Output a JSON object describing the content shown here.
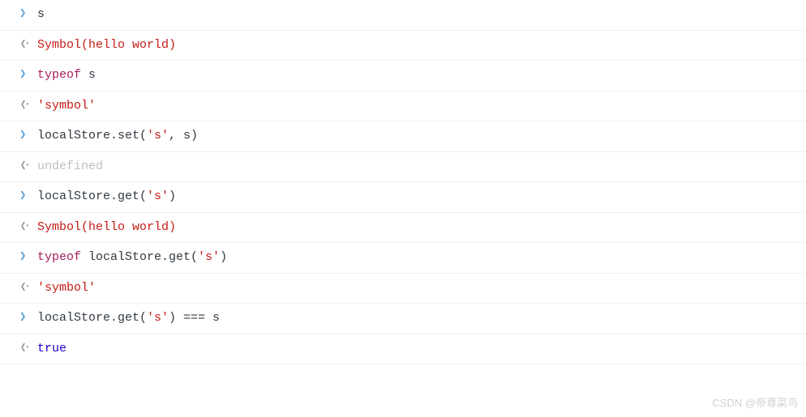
{
  "entries": [
    {
      "kind": "input",
      "tokens": [
        {
          "cls": "ident",
          "t": "s"
        }
      ]
    },
    {
      "kind": "output",
      "tokens": [
        {
          "cls": "sym",
          "t": "Symbol(hello world)"
        }
      ]
    },
    {
      "kind": "input",
      "tokens": [
        {
          "cls": "kw",
          "t": "typeof"
        },
        {
          "cls": "ident",
          "t": " s"
        }
      ]
    },
    {
      "kind": "output",
      "tokens": [
        {
          "cls": "str",
          "t": "'symbol'"
        }
      ]
    },
    {
      "kind": "input",
      "tokens": [
        {
          "cls": "ident",
          "t": "localStore.set("
        },
        {
          "cls": "str",
          "t": "'s'"
        },
        {
          "cls": "ident",
          "t": ", s)"
        }
      ]
    },
    {
      "kind": "output",
      "tokens": [
        {
          "cls": "undef",
          "t": "undefined"
        }
      ]
    },
    {
      "kind": "input",
      "tokens": [
        {
          "cls": "ident",
          "t": "localStore.get("
        },
        {
          "cls": "str",
          "t": "'s'"
        },
        {
          "cls": "ident",
          "t": ")"
        }
      ]
    },
    {
      "kind": "output",
      "tokens": [
        {
          "cls": "sym",
          "t": "Symbol(hello world)"
        }
      ]
    },
    {
      "kind": "input",
      "tokens": [
        {
          "cls": "kw",
          "t": "typeof"
        },
        {
          "cls": "ident",
          "t": " localStore.get("
        },
        {
          "cls": "str",
          "t": "'s'"
        },
        {
          "cls": "ident",
          "t": ")"
        }
      ]
    },
    {
      "kind": "output",
      "tokens": [
        {
          "cls": "str",
          "t": "'symbol'"
        }
      ]
    },
    {
      "kind": "input",
      "tokens": [
        {
          "cls": "ident",
          "t": "localStore.get("
        },
        {
          "cls": "str",
          "t": "'s'"
        },
        {
          "cls": "ident",
          "t": ") === s"
        }
      ]
    },
    {
      "kind": "output",
      "tokens": [
        {
          "cls": "bool",
          "t": "true"
        }
      ]
    }
  ],
  "markers": {
    "input": "❯",
    "output": "❮⸱"
  },
  "watermark": "CSDN @帝尊菜鸟"
}
